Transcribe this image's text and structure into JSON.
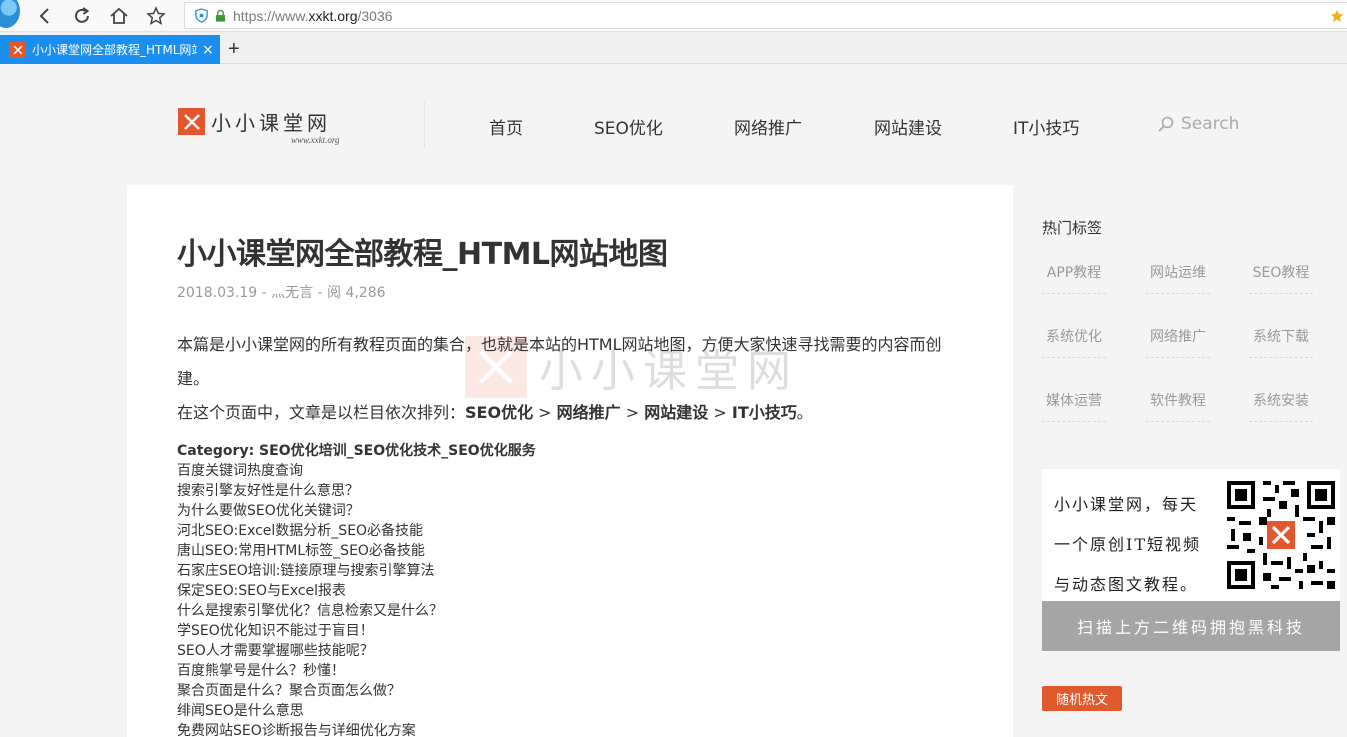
{
  "browser": {
    "url_prefix": "https://www.",
    "url_host": "xxkt.org",
    "url_path": "/3036",
    "tab_title": "小小课堂网全部教程_HTML网站地图",
    "tab_close": "×",
    "new_tab": "+"
  },
  "site": {
    "logo_name": "小小课堂网",
    "logo_url": "www.xxkt.org",
    "nav": [
      "首页",
      "SEO优化",
      "网络推广",
      "网站建设",
      "IT小技巧"
    ],
    "search_placeholder": "Search",
    "accent_color": "#e4572e"
  },
  "article": {
    "title": "小小课堂网全部教程_HTML网站地图",
    "meta": "2018.03.19 - 灬无言 - 阅 4,286",
    "intro_line1": "本篇是小小课堂网的所有教程页面的集合，也就是本站的HTML网站地图，方便大家快速寻找需要的内容而创建。",
    "intro_line2_prefix": "在这个页面中，文章是以栏目依次排列：",
    "intro_crumbs": [
      "SEO优化",
      "网络推广",
      "网站建设",
      "IT小技巧"
    ],
    "intro_separator": ">",
    "intro_end": "。",
    "category": "Category: SEO优化培训_SEO优化技术_SEO优化服务",
    "links": [
      "百度关键词热度查询",
      "搜索引擎友好性是什么意思？",
      "为什么要做SEO优化关键词？",
      "河北SEO:Excel数据分析_SEO必备技能",
      "唐山SEO:常用HTML标签_SEO必备技能",
      "石家庄SEO培训:链接原理与搜索引擎算法",
      "保定SEO:SEO与Excel报表",
      "什么是搜索引擎优化？信息检索又是什么？",
      "学SEO优化知识不能过于盲目！",
      "SEO人才需要掌握哪些技能呢？",
      "百度熊掌号是什么？秒懂！",
      "聚合页面是什么？聚合页面怎么做？",
      "绯闻SEO是什么意思",
      "免费网站SEO诊断报告与详细优化方案"
    ]
  },
  "sidebar": {
    "hot_tags_title": "热门标签",
    "tags": [
      "APP教程",
      "网站运维",
      "SEO教程",
      "系统优化",
      "网络推广",
      "系统下载",
      "媒体运营",
      "软件教程",
      "系统安装"
    ],
    "qr_lines": [
      "小小课堂网，每天",
      "一个原创IT短视频",
      "与动态图文教程。"
    ],
    "qr_caption": "扫描上方二维码拥抱黑科技",
    "random_button": "随机热文"
  }
}
